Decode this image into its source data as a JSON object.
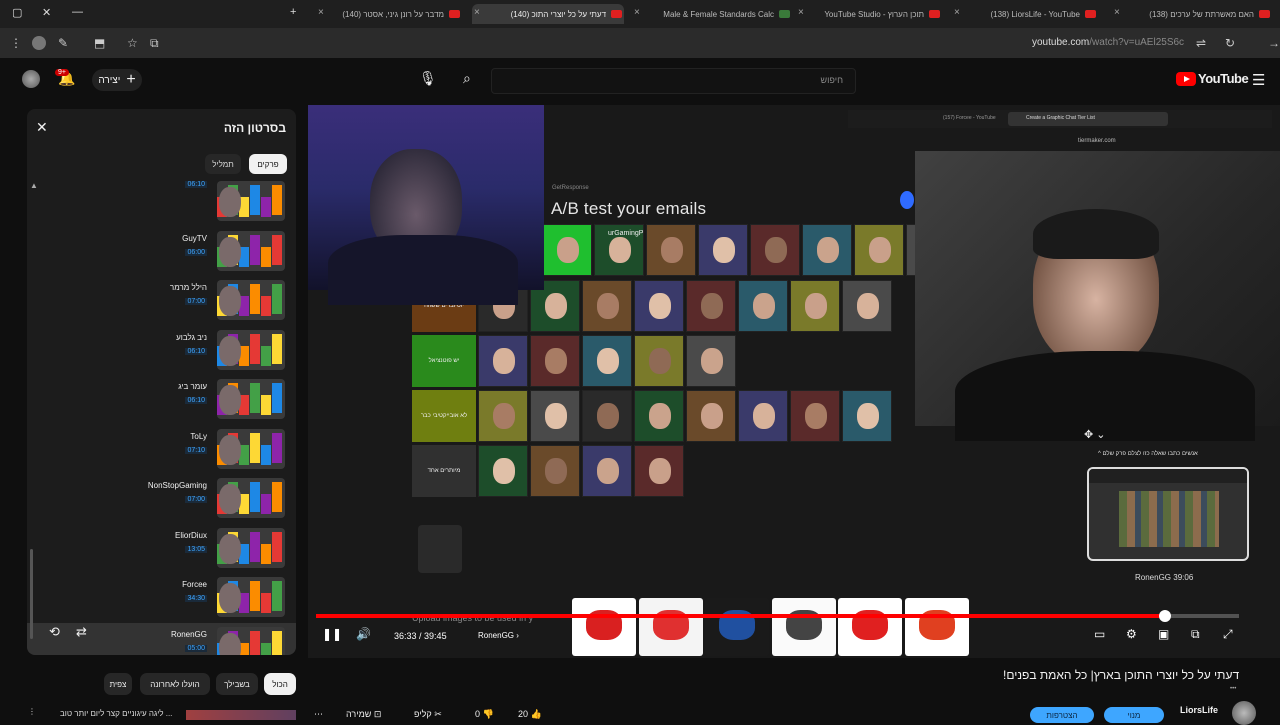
{
  "tabs": [
    {
      "title": "(140) מדבר על רונן גיני, אסטר",
      "active": false
    },
    {
      "title": "(140) דעתי על כל יוצרי התוכ",
      "active": true
    },
    {
      "title": "Male & Female Standards Calc",
      "active": false
    },
    {
      "title": "YouTube Studio - תוכן הערוץ",
      "active": false
    },
    {
      "title": "(138) LiorsLife - YouTube",
      "active": false
    },
    {
      "title": "(138) האם מאשרתת של ערכים",
      "active": false
    }
  ],
  "address": {
    "host": "youtube.com",
    "path": "/watch?v=uAEl25S6c"
  },
  "header": {
    "logo": "YouTube",
    "search_placeholder": "חיפוש",
    "create_label": "יצירה",
    "notifications": "9+"
  },
  "panel": {
    "title": "בסרטון הזה",
    "chips": [
      "פרקים",
      "תמליל"
    ],
    "chapters": [
      {
        "name": "",
        "time": "06:10",
        "current": false
      },
      {
        "name": "GuyTV",
        "time": "06:00",
        "current": false
      },
      {
        "name": "הילל מרמר",
        "time": "07:00",
        "current": false
      },
      {
        "name": "ניב גלבוע",
        "time": "06:10",
        "current": false
      },
      {
        "name": "עומר ביג",
        "time": "06:10",
        "current": false
      },
      {
        "name": "ToLy",
        "time": "07:10",
        "current": false
      },
      {
        "name": "NonStopGaming",
        "time": "07:00",
        "current": false
      },
      {
        "name": "EliorDiux",
        "time": "13:05",
        "current": false
      },
      {
        "name": "Forcee",
        "time": "34:30",
        "current": false
      },
      {
        "name": "RonenGG",
        "time": "05:00",
        "current": true
      }
    ]
  },
  "video": {
    "inner_tabs": [
      "(157) Forcee - YouTube",
      "Create a Graphic Chat Tier List"
    ],
    "inner_url": "tiermaker.com",
    "ab_small": "GetResponse",
    "ab_test": "A/B test your emails",
    "yt_label": "urGamingP",
    "tiers": [
      {
        "label": "יוטיוברים ששווה",
        "color": "#6b3c14"
      },
      {
        "label": "יש פוטנציאל",
        "color": "#2a8a1c"
      },
      {
        "label": "לא אובייקטיבי כבר",
        "color": "#6f7f10"
      },
      {
        "label": "מיותרים אחד",
        "color": "#303030"
      }
    ],
    "preview_label": "RonenGG  39:06",
    "chapter_note": "^ אנשים כתבו שאלה כזו לצלם פרק שלם",
    "upload_note": "Upload images to be used in y",
    "time_current": "36:33",
    "time_total": "39:45",
    "chapter_current": "RonenGG",
    "progress": 0.92
  },
  "below": {
    "title": "דעתי על כל יוצרי התוכן בארץ| כל האמת בפנים!",
    "channel": "LiorsLife",
    "subscribe": "מנוי",
    "join": "הצטרפות",
    "likes": "20",
    "dislikes": "0",
    "share": "שיתוף",
    "clip": "קליפ",
    "tags": [
      "הכול",
      "בשבילך",
      "הועלו לאחרונה",
      "צפית"
    ],
    "related_title": "ליגה עיגוניים קצר ליום יותר טוב ..."
  },
  "colors": {
    "accent": "#ff0000",
    "link": "#3ea6ff",
    "bg": "#0f0f0f"
  }
}
